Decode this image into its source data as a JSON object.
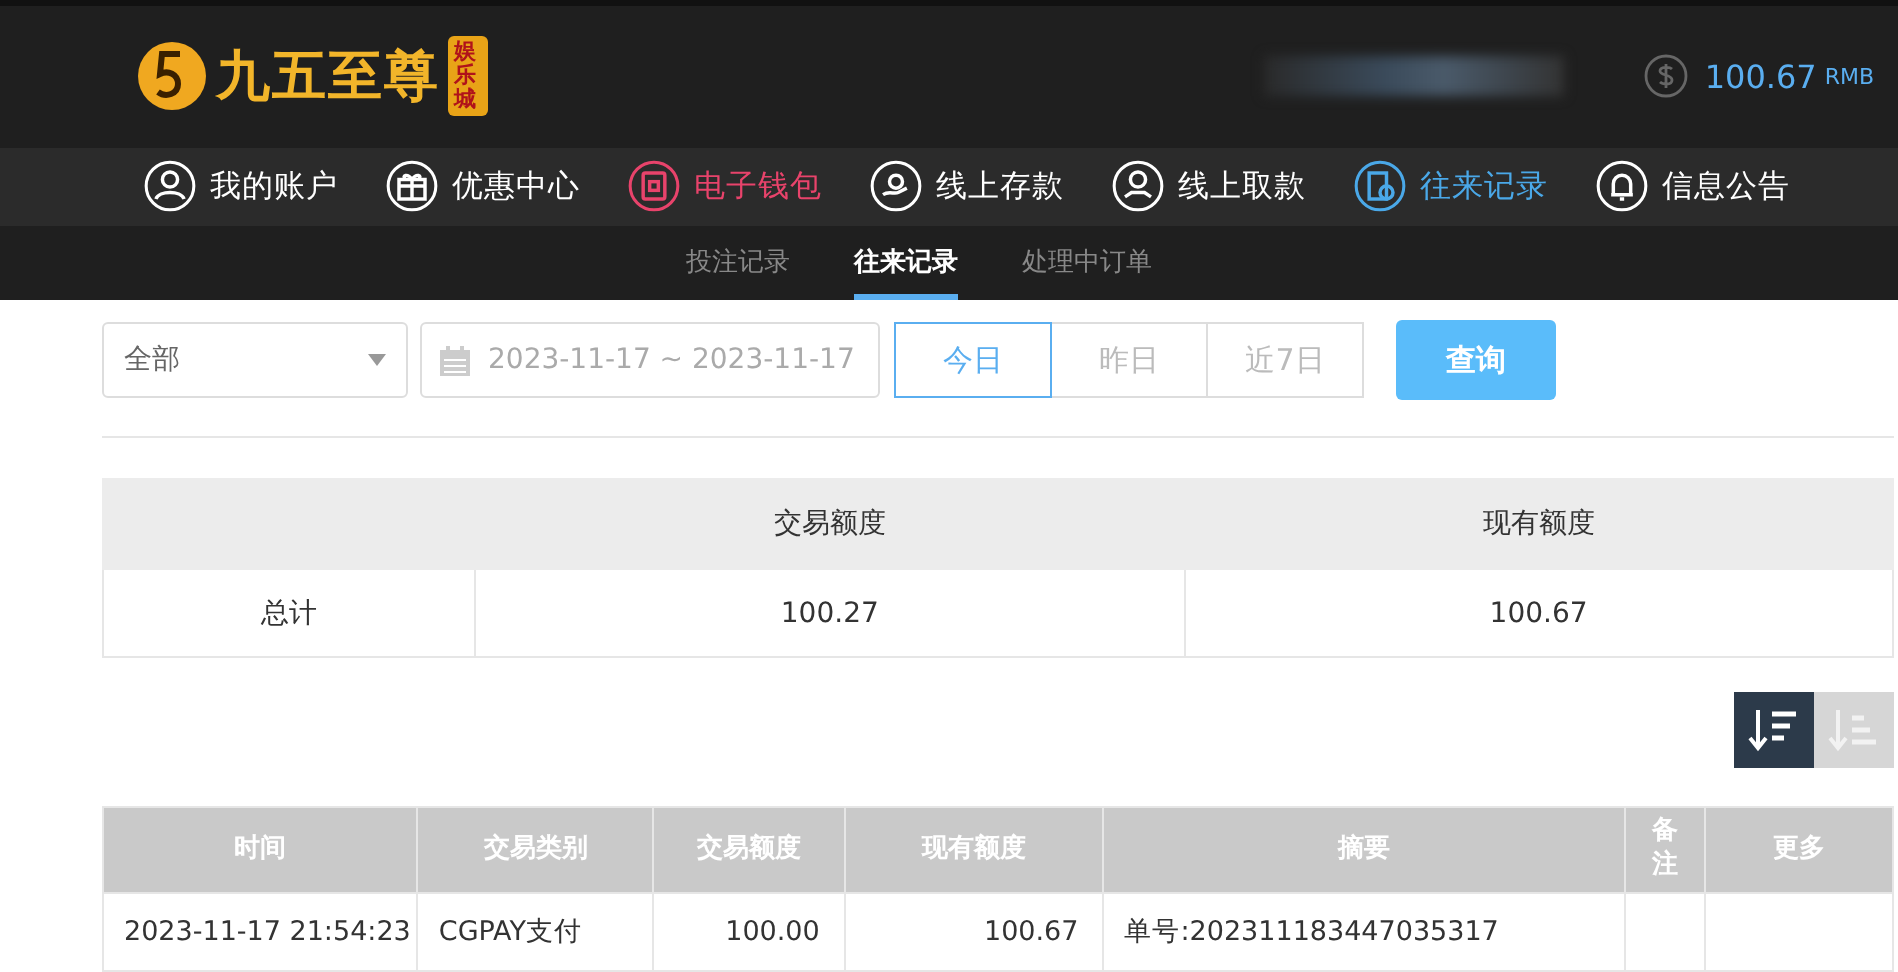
{
  "header": {
    "logo_text": "九五至尊",
    "logo_badge": "娱乐城",
    "balance": "100.67",
    "currency": "RMB"
  },
  "nav": [
    {
      "label": "我的账户",
      "kind": "user",
      "color": "#ffffff"
    },
    {
      "label": "优惠中心",
      "kind": "gift",
      "color": "#ffffff"
    },
    {
      "label": "电子钱包",
      "kind": "wallet",
      "color": "#e8436b"
    },
    {
      "label": "线上存款",
      "kind": "deposit",
      "color": "#ffffff"
    },
    {
      "label": "线上取款",
      "kind": "withdraw",
      "color": "#ffffff"
    },
    {
      "label": "往来记录",
      "kind": "records",
      "color": "#4aa8e8"
    },
    {
      "label": "信息公告",
      "kind": "bell",
      "color": "#ffffff"
    }
  ],
  "subnav": [
    {
      "label": "投注记录",
      "selected": false
    },
    {
      "label": "往来记录",
      "selected": true
    },
    {
      "label": "处理中订单",
      "selected": false
    }
  ],
  "filters": {
    "type": "全部",
    "date_range": "2023-11-17 ~ 2023-11-17",
    "quick": [
      {
        "label": "今日",
        "selected": true
      },
      {
        "label": "昨日",
        "selected": false
      },
      {
        "label": "近7日",
        "selected": false
      }
    ],
    "query_button": "查询"
  },
  "summary": {
    "columns": [
      "",
      "交易额度",
      "现有额度"
    ],
    "row": [
      "总计",
      "100.27",
      "100.67"
    ]
  },
  "sort": [
    {
      "kind": "desc",
      "selected": true
    },
    {
      "kind": "asc",
      "selected": false
    }
  ],
  "table": {
    "columns": [
      "时间",
      "交易类别",
      "交易额度",
      "现有额度",
      "摘要",
      "备注",
      "更多"
    ],
    "rows": [
      [
        "2023-11-17 21:54:23",
        "CGPAY支付",
        "100.00",
        "100.67",
        "单号:202311183447035317",
        "",
        ""
      ]
    ]
  }
}
